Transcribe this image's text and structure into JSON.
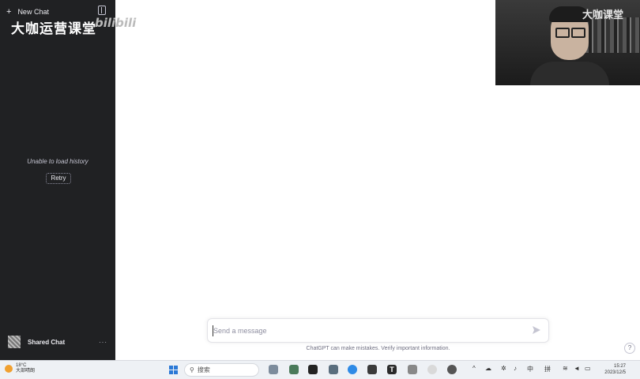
{
  "sidebar": {
    "new_chat_label": "New Chat",
    "watermark_text": "大咖运营课堂",
    "bilibili_logo": "bilibili",
    "history_error": "Unable to load history",
    "retry_label": "Retry",
    "shared_chat_label": "Shared Chat",
    "more_label": "···"
  },
  "webcam": {
    "watermark_text": "大咖课堂"
  },
  "composer": {
    "placeholder": "Send a message",
    "disclaimer": "ChatGPT can make mistakes. Verify important information."
  },
  "help_label": "?",
  "taskbar": {
    "weather_temp": "18°C",
    "weather_desc": "大部晴朗",
    "search_label": "搜索",
    "tray_lang": "中",
    "tray_ime": "拼",
    "time": "15:27",
    "date": "2023/12/5"
  },
  "colors": {
    "sidebar_bg": "#202123",
    "send_icon": "#c5c5d2",
    "windows_accent": "#2b79d6"
  },
  "icons": [
    "plus-icon",
    "sidebar-toggle-icon",
    "send-icon",
    "windows-start-icon",
    "search-icon",
    "wifi-icon",
    "volume-icon",
    "battery-icon"
  ]
}
